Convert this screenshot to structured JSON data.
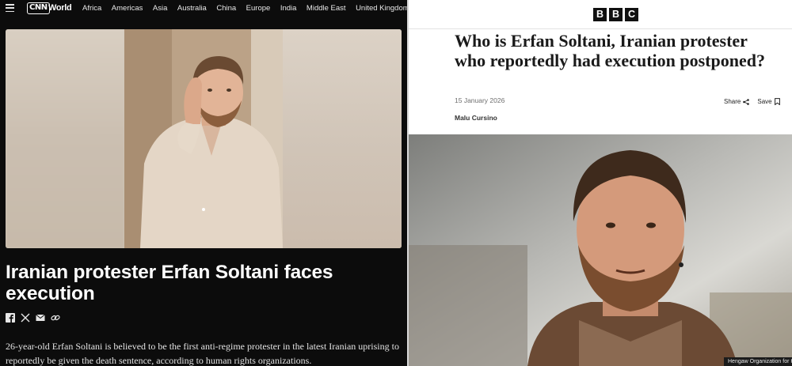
{
  "cnn": {
    "logo_text": "CNN",
    "section": "World",
    "nav": [
      "Africa",
      "Americas",
      "Asia",
      "Australia",
      "China",
      "Europe",
      "India",
      "Middle East",
      "United Kingdom"
    ],
    "headline": "Iranian protester Erfan Soltani faces execution",
    "share_icons": [
      "facebook-icon",
      "x-icon",
      "email-icon",
      "link-icon"
    ],
    "body": "26-year-old Erfan Soltani is believed to be the first anti-regime protester in the latest Iranian uprising to reportedly be given the death sentence, according to human rights organizations."
  },
  "bbc": {
    "logo_letters": [
      "B",
      "B",
      "C"
    ],
    "title": "Who is Erfan Soltani, Iranian protester who reportedly had execution postponed?",
    "date": "15 January 2026",
    "share_label": "Share",
    "save_label": "Save",
    "author": "Malu Cursino",
    "photo_caption": "Hengaw Organization for Hu"
  },
  "colors": {
    "cnn_background": "#0c0c0c",
    "bbc_background": "#ffffff",
    "bbc_logo_block": "#111111"
  }
}
